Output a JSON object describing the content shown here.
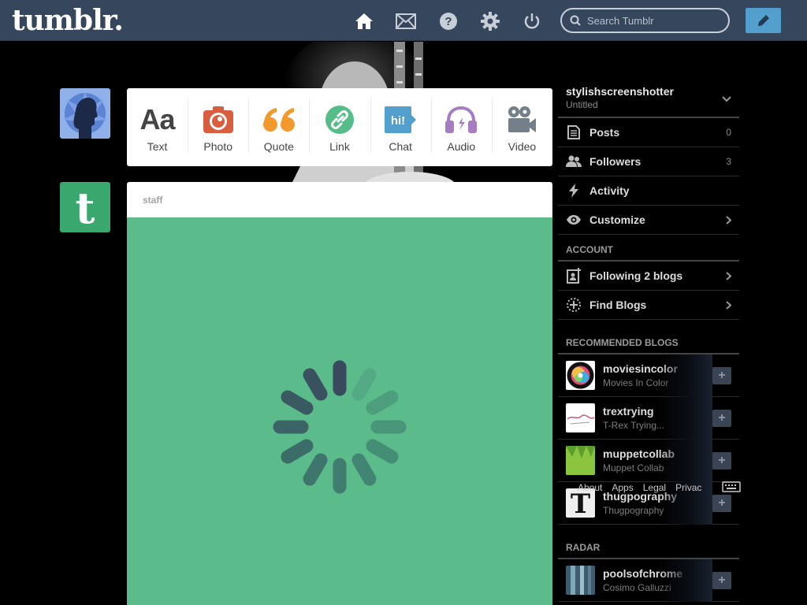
{
  "header": {
    "logo": "tumblr.",
    "search_placeholder": "Search Tumblr",
    "nav": [
      "home-icon",
      "mail-icon",
      "help-icon",
      "settings-icon",
      "power-icon"
    ]
  },
  "post_types": [
    {
      "label": "Text",
      "icon": "text-aa-icon",
      "color": "#444444",
      "glyph": "Aa"
    },
    {
      "label": "Photo",
      "icon": "camera-icon",
      "color": "#d95e40"
    },
    {
      "label": "Quote",
      "icon": "quote-icon",
      "color": "#f2992e",
      "glyph": "“"
    },
    {
      "label": "Link",
      "icon": "link-icon",
      "color": "#56bc8a"
    },
    {
      "label": "Chat",
      "icon": "chat-icon",
      "color": "#529ecc",
      "glyph": "hi!"
    },
    {
      "label": "Audio",
      "icon": "headphones-icon",
      "color": "#a77dc2"
    },
    {
      "label": "Video",
      "icon": "video-camera-icon",
      "color": "#748089"
    }
  ],
  "post": {
    "author": "staff",
    "body_color": "#5bbb8a"
  },
  "sidebar": {
    "blog_name": "stylishscreenshotter",
    "blog_title": "Untitled",
    "items": [
      {
        "label": "Posts",
        "count": "0",
        "icon": "posts-icon"
      },
      {
        "label": "Followers",
        "count": "3",
        "icon": "followers-icon"
      },
      {
        "label": "Activity",
        "icon": "lightning-icon"
      },
      {
        "label": "Customize",
        "icon": "eye-icon"
      }
    ],
    "account_heading": "ACCOUNT",
    "account_items": [
      {
        "label": "Following 2 blogs",
        "icon": "following-icon"
      },
      {
        "label": "Find Blogs",
        "icon": "find-blogs-icon"
      }
    ],
    "recommended_heading": "RECOMMENDED BLOGS",
    "recommended": [
      {
        "name": "moviesincolor",
        "title": "Movies In Color"
      },
      {
        "name": "trextrying",
        "title": "T-Rex Trying..."
      },
      {
        "name": "muppetcollab",
        "title": "Muppet Collab"
      },
      {
        "name": "thugpography",
        "title": "Thugpography"
      }
    ],
    "radar_heading": "RADAR",
    "radar": [
      {
        "name": "poolsofchrome",
        "title": "Cosimo Galluzzi"
      }
    ]
  },
  "footer": {
    "links": [
      "About",
      "Apps",
      "Legal",
      "Privac"
    ]
  },
  "colors": {
    "header_bg": "#36465d",
    "accent": "#529ecc",
    "page_bg": "#000000"
  }
}
